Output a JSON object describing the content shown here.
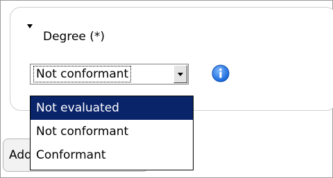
{
  "field": {
    "label": "Degree (*)",
    "selected_value": "Not conformant",
    "info_icon": "info-icon",
    "collapse_icon": "collapse-arrow-icon"
  },
  "dropdown": {
    "options": [
      "Not evaluated",
      "Not conformant",
      "Conformant"
    ],
    "highlighted": "Not evaluated"
  },
  "add_button": {
    "label": "Add"
  },
  "colors": {
    "highlight": "#0a246a",
    "info_blue": "#1a73e8"
  }
}
